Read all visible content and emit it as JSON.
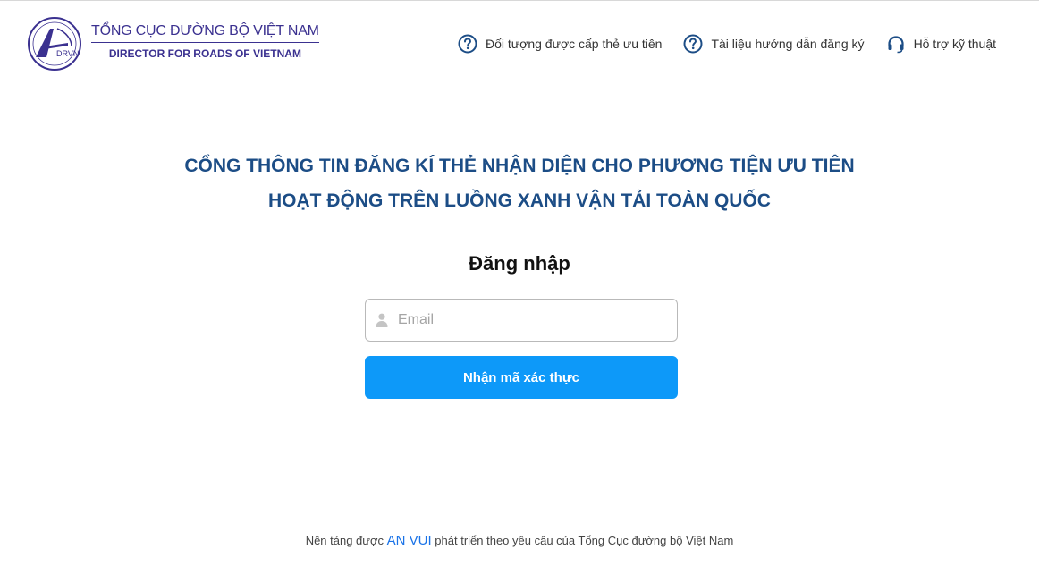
{
  "header": {
    "brand_title": "TỔNG CỤC ĐƯỜNG BỘ VIỆT NAM",
    "brand_subtitle": "DIRECTOR FOR ROADS OF VIETNAM",
    "logo_text": "DRVN",
    "nav": [
      {
        "label": "Đối tượng được cấp thẻ ưu tiên",
        "icon": "question-circle-icon"
      },
      {
        "label": "Tài liệu hướng dẫn đăng ký",
        "icon": "question-circle-icon"
      },
      {
        "label": "Hỗ trợ kỹ thuật",
        "icon": "headset-icon"
      }
    ]
  },
  "headline": {
    "line1": "CỔNG THÔNG TIN ĐĂNG KÍ THẺ NHẬN DIỆN CHO PHƯƠNG TIỆN ƯU TIÊN",
    "line2": "HOẠT ĐỘNG TRÊN LUỒNG XANH VẬN TẢI TOÀN QUỐC"
  },
  "login": {
    "title": "Đăng nhập",
    "email_placeholder": "Email",
    "email_value": "",
    "submit_label": "Nhận mã xác thực"
  },
  "footer": {
    "prefix": "Nền tảng được",
    "brand": "AN VUI",
    "suffix": "phát triển theo yêu cầu của Tổng Cục đường bộ Việt Nam"
  },
  "colors": {
    "brand_purple": "#3b3190",
    "headline_blue": "#1c4d86",
    "button_blue": "#0d99f9",
    "link_blue": "#1a73e8"
  }
}
